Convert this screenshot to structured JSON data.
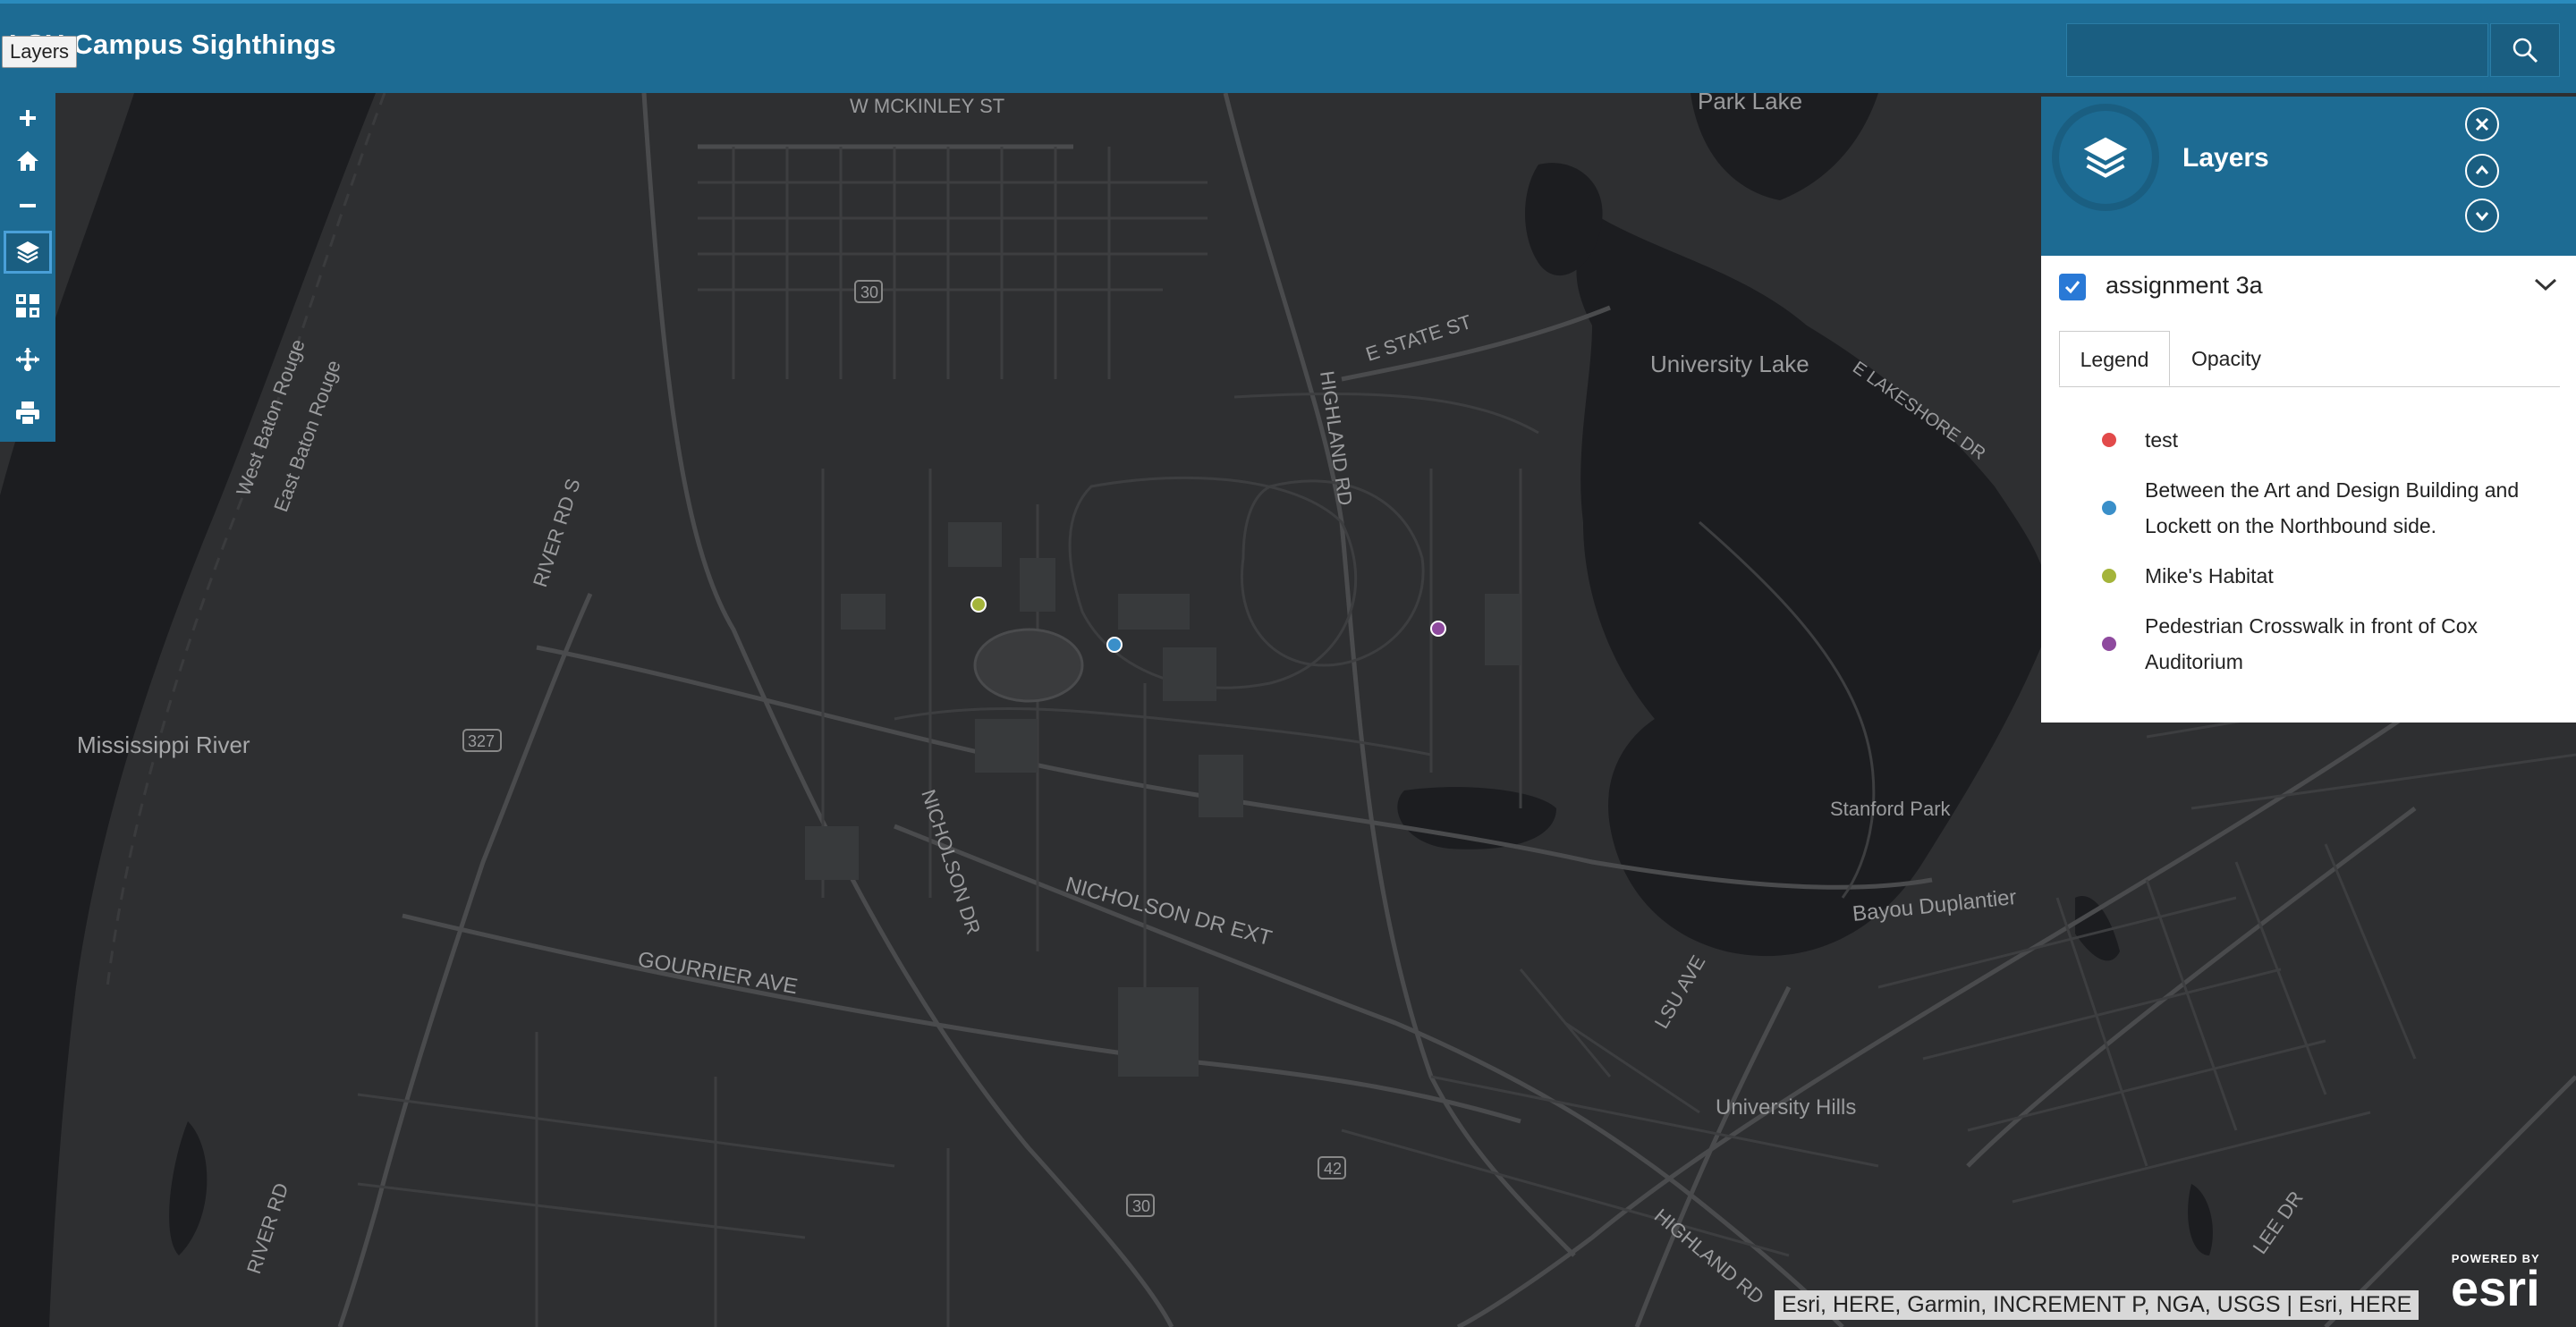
{
  "header": {
    "title": "LSU Campus Sighthings",
    "tooltip": "Layers",
    "search": {
      "placeholder": "",
      "value": ""
    }
  },
  "toolbar": {
    "tools": [
      "zoom-in",
      "home",
      "zoom-out",
      "layers",
      "basemap-gallery",
      "measurement",
      "print"
    ],
    "active": "layers"
  },
  "map": {
    "labels": {
      "w_mckinley": "W MCKINLEY ST",
      "park_lake": "Park Lake",
      "e_state": "E STATE ST",
      "university_lake": "University Lake",
      "e_lakeshore": "E LAKESHORE DR",
      "highland_rd": "HIGHLAND RD",
      "river_rd_s": "RIVER RD S",
      "west_baton_rouge": "West Baton Rouge",
      "east_baton_rouge": "East Baton Rouge",
      "mississippi": "Mississippi River",
      "nicholson_dr": "NICHOLSON DR",
      "nicholson_dr_ext": "NICHOLSON DR EXT",
      "gourrier": "GOURRIER AVE",
      "stanford_park": "Stanford Park",
      "bayou": "Bayou Duplantier",
      "lsu_ave": "LSU AVE",
      "university_hills": "University Hills",
      "highland_rd_2": "HIGHLAND RD",
      "lee_dr": "LEE DR",
      "river_rd": "RIVER RD",
      "shield_30a": "30",
      "shield_327": "327",
      "shield_42": "42",
      "shield_30b": "30"
    },
    "sightings": [
      {
        "name": "Mike's Habitat",
        "color": "#a4b43a"
      },
      {
        "name": "Between the Art and Design Building and Lockett on the Northbound side.",
        "color": "#3a8fc9"
      },
      {
        "name": "Pedestrian Crosswalk in front of Cox Auditorium",
        "color": "#8e4a9e"
      }
    ]
  },
  "layers_panel": {
    "title": "Layers",
    "layer_name": "assignment 3a",
    "layer_checked": true,
    "tabs": [
      "Legend",
      "Opacity"
    ],
    "active_tab": "Legend",
    "legend": [
      {
        "label": "test",
        "color": "#e24a4a"
      },
      {
        "label": "Between the Art and Design Building and Lockett on the Northbound side.",
        "color": "#3a8fc9"
      },
      {
        "label": "Mike's Habitat",
        "color": "#a4b43a"
      },
      {
        "label": "Pedestrian Crosswalk in front of Cox Auditorium",
        "color": "#8e4a9e"
      }
    ]
  },
  "attribution": "Esri, HERE, Garmin, INCREMENT P, NGA, USGS | Esri, HERE",
  "esri_logo": {
    "small": "POWERED BY",
    "big": "esri"
  }
}
